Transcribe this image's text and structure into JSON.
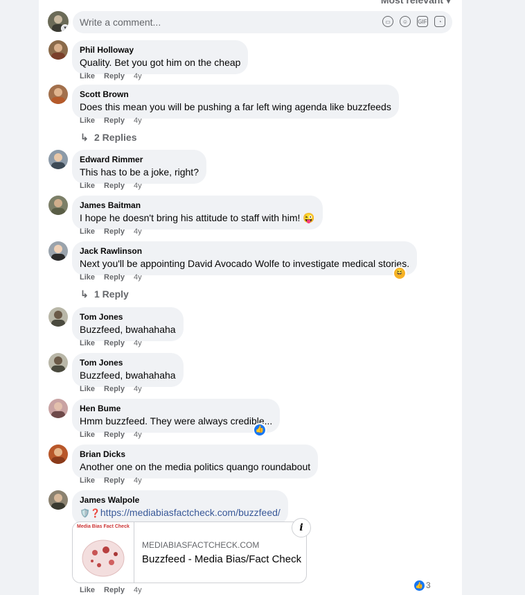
{
  "sort_label": "Most relevant",
  "composer": {
    "placeholder": "Write a comment...",
    "icons": [
      "sticker-icon",
      "emoji-icon",
      "gif-icon",
      "sticker2-icon"
    ]
  },
  "comments": [
    {
      "name": "Phil Holloway",
      "text": "Quality. Bet you got him on the cheap",
      "like": "Like",
      "reply": "Reply",
      "time": "4y"
    },
    {
      "name": "Scott Brown",
      "text": "Does this mean you will be pushing a far left wing agenda like buzzfeeds",
      "like": "Like",
      "reply": "Reply",
      "time": "4y",
      "replies": "2 Replies"
    },
    {
      "name": "Edward Rimmer",
      "text": "This has to be a joke, right?",
      "like": "Like",
      "reply": "Reply",
      "time": "4y"
    },
    {
      "name": "James Baitman",
      "text": "I hope he doesn't bring his attitude to staff with him! 😜",
      "like": "Like",
      "reply": "Reply",
      "time": "4y"
    },
    {
      "name": "Jack Rawlinson",
      "text": "Next you'll be appointing David Avocado Wolfe to investigate medical stories.",
      "like": "Like",
      "reply": "Reply",
      "time": "4y",
      "replies": "1 Reply",
      "reaction": "😆"
    },
    {
      "name": "Tom Jones",
      "text": "Buzzfeed, bwahahaha",
      "like": "Like",
      "reply": "Reply",
      "time": "4y"
    },
    {
      "name": "Tom Jones",
      "text": "Buzzfeed, bwahahaha",
      "like": "Like",
      "reply": "Reply",
      "time": "4y"
    },
    {
      "name": "Hen Bume",
      "text": "Hmm buzzfeed. They were always credible...",
      "like": "Like",
      "reply": "Reply",
      "time": "4y",
      "reaction": "👍"
    },
    {
      "name": "Brian Dicks",
      "text": "Another one on the media politics quango roundabout",
      "like": "Like",
      "reply": "Reply",
      "time": "4y"
    },
    {
      "name": "James Walpole",
      "text": "https://mediabiasfactcheck.com/buzzfeed/",
      "like": "Like",
      "reply": "Reply",
      "time": "4y",
      "link_prefix": "🛡️❓"
    }
  ],
  "link_card": {
    "thumb_label": "Media Bias Fact Check",
    "domain": "MEDIABIASFACTCHECK.COM",
    "title": "Buzzfeed - Media Bias/Fact Check",
    "info": "i"
  },
  "last_like_count": "3",
  "colors": {
    "bubble": "#f0f2f5",
    "link": "#385898",
    "like_blue": "#1877f2",
    "muted": "#65676b"
  }
}
